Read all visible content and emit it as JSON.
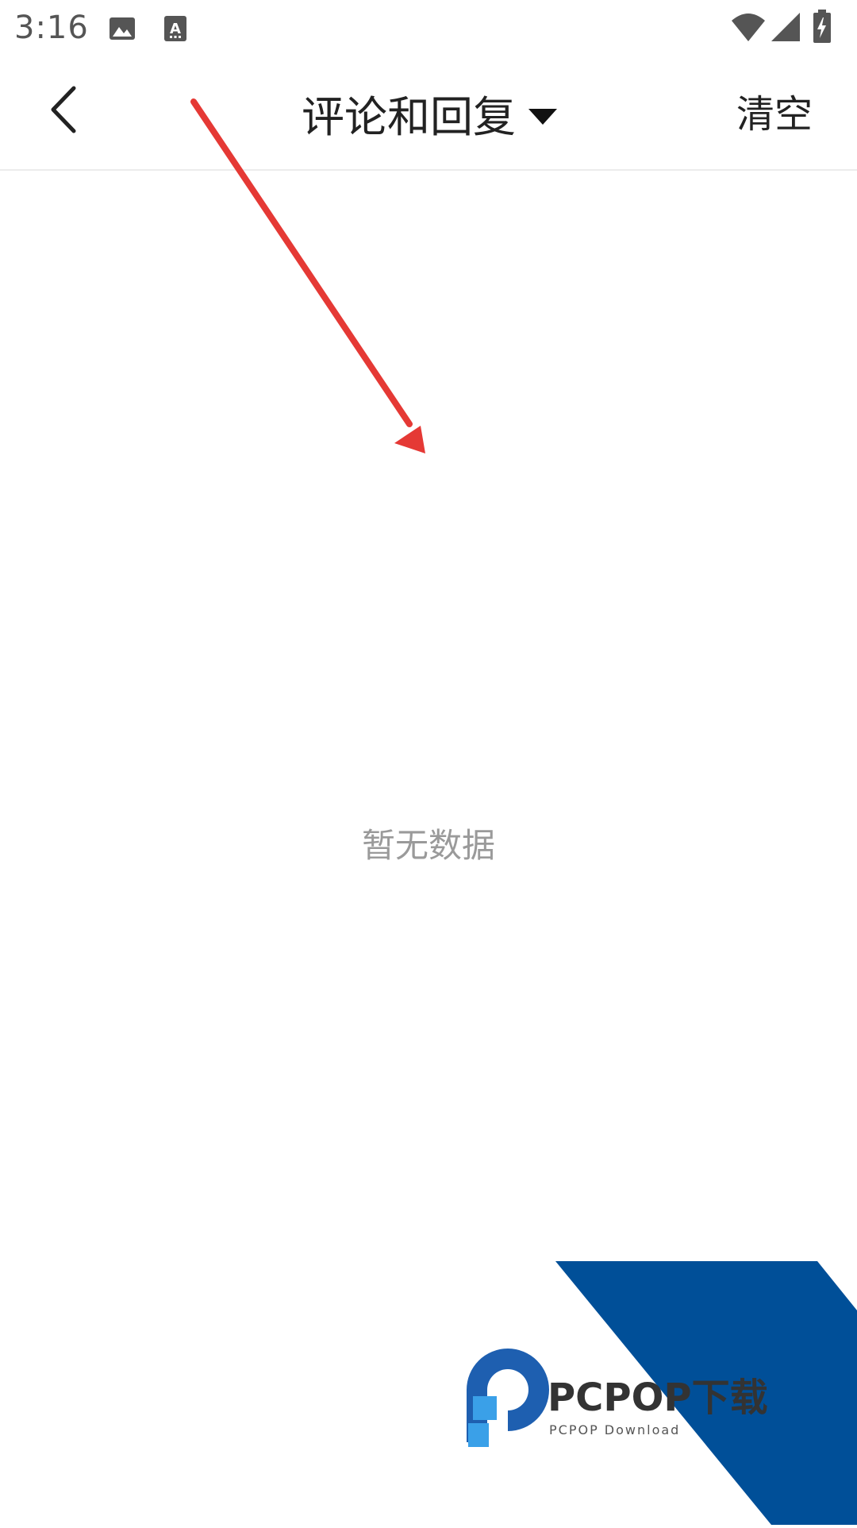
{
  "status_bar": {
    "time": "3:16",
    "icons": [
      "image-icon",
      "a-notification-icon",
      "wifi-icon",
      "signal-icon",
      "battery-charging-icon"
    ]
  },
  "toolbar": {
    "back_icon": "chevron-left-icon",
    "title": "评论和回复",
    "title_dropdown_icon": "caret-down-icon",
    "clear_label": "清空"
  },
  "main": {
    "empty_text": "暂无数据"
  },
  "annotation": {
    "arrow_color": "#e53935"
  },
  "watermark": {
    "brand": "PCPOP下载",
    "subtitle": "PCPOP Download",
    "colors": {
      "banner": "#004f98",
      "logo_blue": "#1e5fb0",
      "logo_light": "#3aa0e8",
      "text_dark": "#333333"
    }
  }
}
